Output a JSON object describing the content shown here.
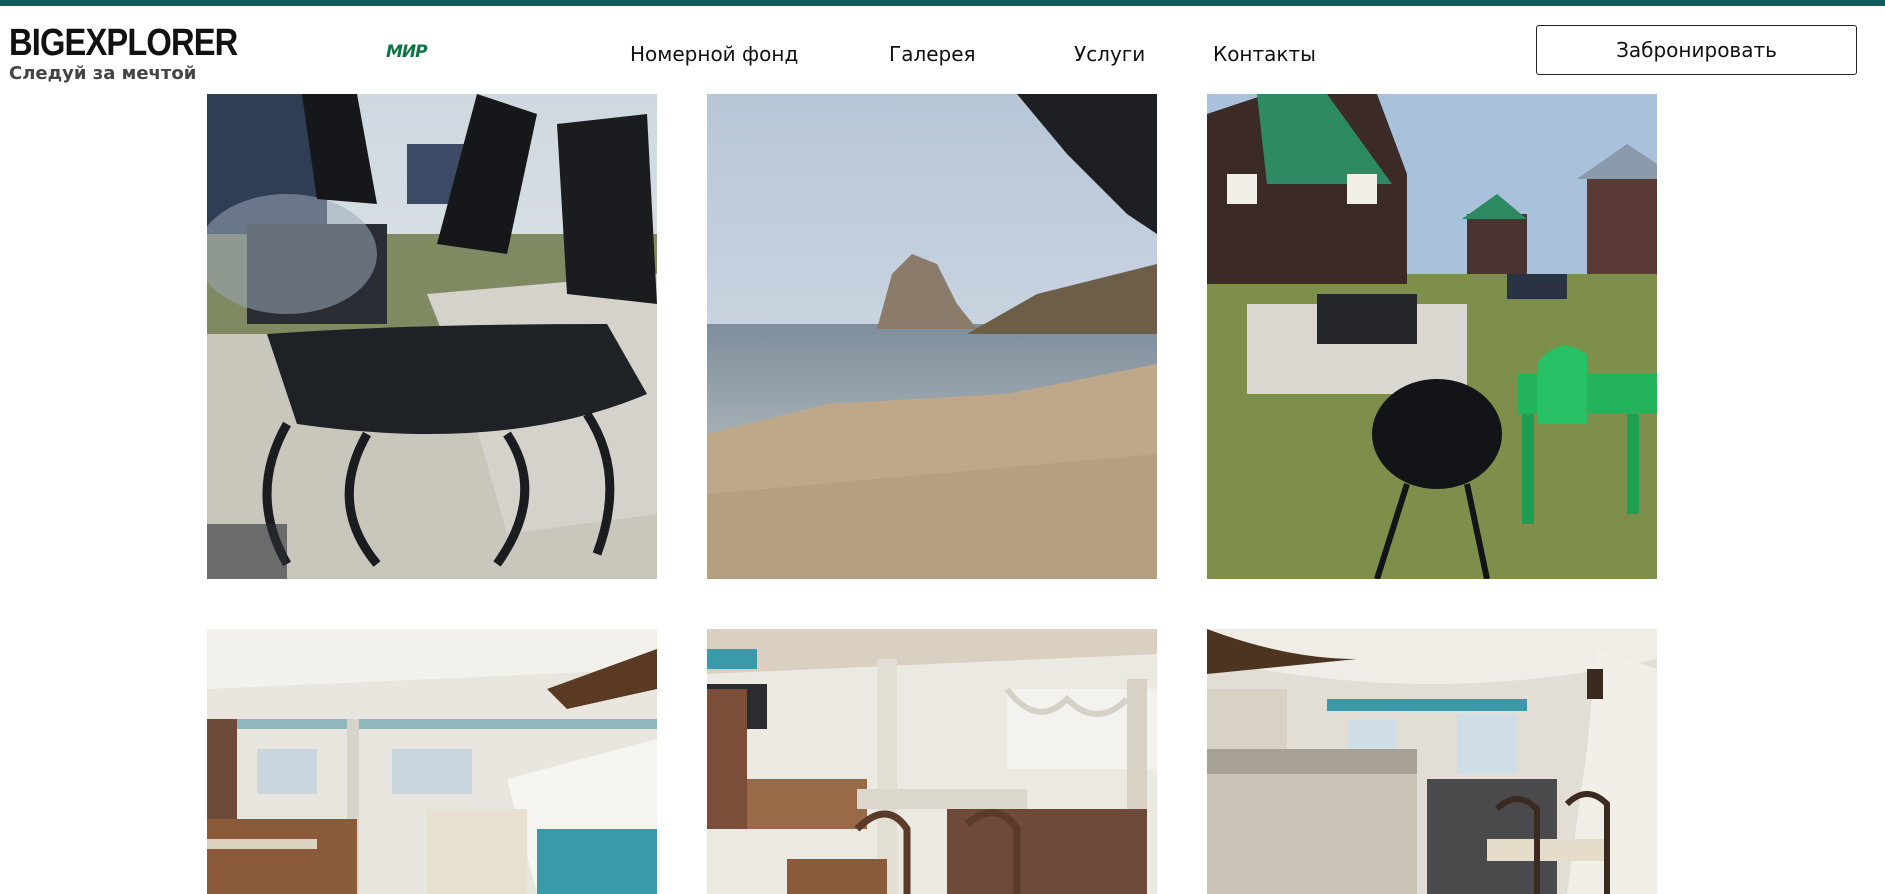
{
  "header": {
    "logo_title": "BIGEXPLORER",
    "logo_subtitle": "Следуй за мечтой",
    "payment_badge": "МИР",
    "nav": [
      {
        "label": "Номерной фонд"
      },
      {
        "label": "Галерея"
      },
      {
        "label": "Услуги"
      },
      {
        "label": "Контакты"
      }
    ],
    "book_button": "Забронировать"
  },
  "colors": {
    "accent_strip": "#0d5c5e",
    "mir_green": "#0f7545"
  },
  "gallery": {
    "photos": [
      {
        "name": "ship-shaped-grill-photo"
      },
      {
        "name": "lake-beach-rock-photo"
      },
      {
        "name": "yard-with-grills-photo"
      },
      {
        "name": "dining-hall-photo-1"
      },
      {
        "name": "dining-hall-photo-2"
      },
      {
        "name": "dining-hall-photo-3"
      }
    ]
  }
}
